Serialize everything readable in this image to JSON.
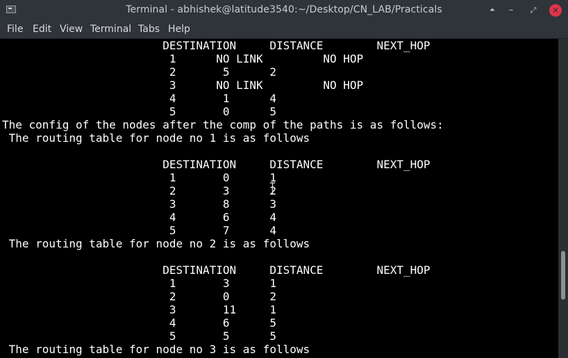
{
  "window": {
    "title": "Terminal - abhishek@latitude3540:~/Desktop/CN_LAB/Practicals",
    "icon": "terminal-app-icon",
    "controls": {
      "keep_above": "⏶",
      "minimize": "–",
      "maximize": "⤢",
      "close": "✕"
    }
  },
  "menubar": {
    "items": [
      "File",
      "Edit",
      "View",
      "Terminal",
      "Tabs",
      "Help"
    ]
  },
  "terminal": {
    "lines": [
      "                        DESTINATION     DISTANCE        NEXT_HOP",
      "                         1      NO LINK         NO HOP",
      "                         2       5      2",
      "                         3      NO LINK         NO HOP",
      "                         4       1      4",
      "                         5       0      5",
      "The config of the nodes after the comp of the paths is as follows:",
      " The routing table for node no 1 is as follows",
      "",
      "                        DESTINATION     DISTANCE        NEXT_HOP",
      "                         1       0      1",
      "                         2       3      2",
      "                         3       8      3",
      "                         4       6      4",
      "                         5       7      4",
      " The routing table for node no 2 is as follows",
      "",
      "                        DESTINATION     DISTANCE        NEXT_HOP",
      "                         1       3      1",
      "                         2       0      2",
      "                         3       11     1",
      "                         4       6      5",
      "                         5       5      5",
      " The routing table for node no 3 is as follows"
    ]
  },
  "colors": {
    "terminal_bg": "#000000",
    "terminal_fg": "#ffffff",
    "chrome_bg": "#2f343a",
    "close_button": "#e0334a"
  }
}
